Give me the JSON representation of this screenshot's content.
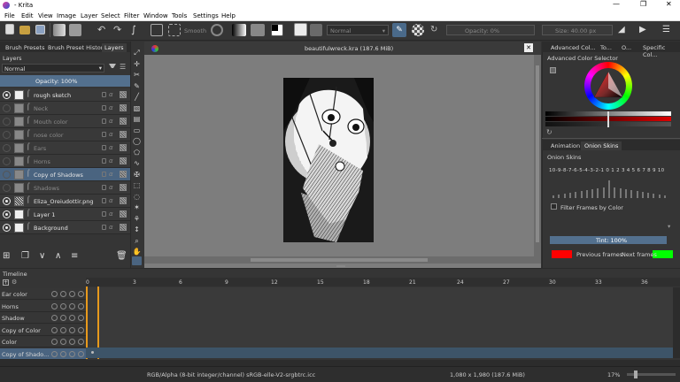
{
  "window": {
    "title": "- Krita"
  },
  "menu": [
    "File",
    "Edit",
    "View",
    "Image",
    "Layer",
    "Select",
    "Filter",
    "Window",
    "Tools",
    "Settings",
    "Help"
  ],
  "toolbar": {
    "brush_tip_label": "Smooth",
    "blend_mode": "Normal",
    "opacity_label": "Opacity: 0%",
    "size_label": "Size: 40.00 px"
  },
  "left_tabs": [
    "Brush Presets",
    "Brush Preset History",
    "Layers"
  ],
  "layers_panel": {
    "title": "Layers",
    "blend_mode": "Normal",
    "opacity": "Opacity:  100%",
    "layers": [
      {
        "name": "rough sketch",
        "visible": true,
        "selected": false
      },
      {
        "name": "Neck",
        "visible": false,
        "selected": false
      },
      {
        "name": "Mouth color",
        "visible": false,
        "selected": false
      },
      {
        "name": "nose color",
        "visible": false,
        "selected": false
      },
      {
        "name": "Ears",
        "visible": false,
        "selected": false
      },
      {
        "name": "Horns",
        "visible": false,
        "selected": false
      },
      {
        "name": "Copy of Shadows",
        "visible": false,
        "selected": true
      },
      {
        "name": "Shadows",
        "visible": false,
        "selected": false
      },
      {
        "name": "Eliza_Oreiudottir.png",
        "visible": true,
        "selected": false
      },
      {
        "name": "Layer 1",
        "visible": true,
        "selected": false
      },
      {
        "name": "Background",
        "visible": true,
        "selected": false
      }
    ]
  },
  "canvas": {
    "doc_title": "beautifulwreck.kra (187.6 MiB)"
  },
  "right_tabs": [
    "Advanced Col...",
    "To...",
    "O...",
    "Specific Col..."
  ],
  "color_selector": {
    "title": "Advanced Color Selector"
  },
  "anim_tabs": [
    "Animation",
    "Onion Skins"
  ],
  "onion": {
    "title": "Onion Skins",
    "scale": "10-9-8-7-6-5-4-3-2-1 0  1 2 3 4 5 6 7 8 9 10",
    "filter_label": "Filter Frames by Color",
    "tint_label": "Tint: 100%",
    "previous_label": "Previous frames",
    "next_label": "Next frames",
    "previous_color": "#ff0000",
    "next_color": "#00ff00"
  },
  "timeline": {
    "title": "Timeline",
    "frames": [
      "0",
      "3",
      "6",
      "9",
      "12",
      "15",
      "18",
      "21",
      "24",
      "27",
      "30",
      "33",
      "36"
    ],
    "rows": [
      "Ear color",
      "Horns",
      "Shadow",
      "Copy of Color",
      "Color",
      "Copy of Shado..."
    ]
  },
  "status": {
    "color_space": "RGB/Alpha (8-bit integer/channel)  sRGB-elle-V2-srgbtrc.icc",
    "dimensions": "1,080 x 1,980 (187.6 MiB)",
    "zoom": "17%"
  },
  "accent_color": "#3d5c7a"
}
